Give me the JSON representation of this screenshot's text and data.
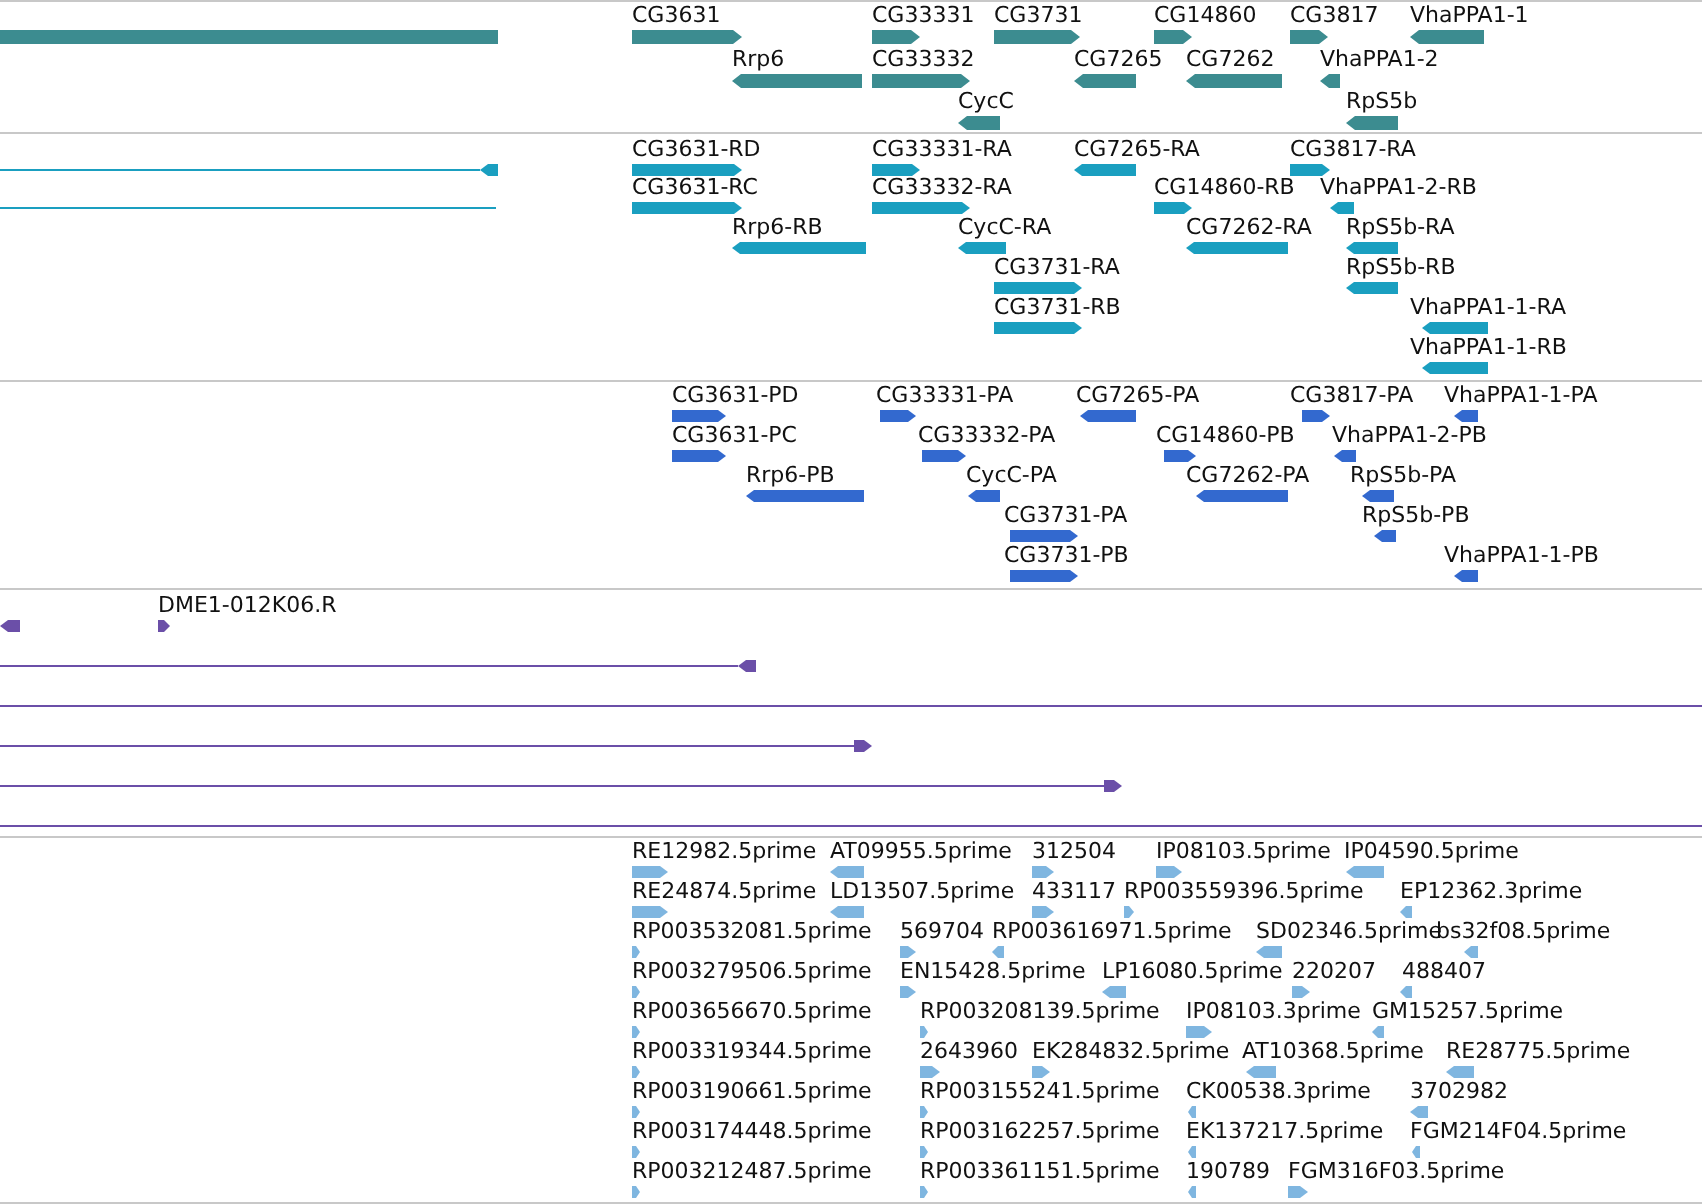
{
  "tracks": [
    {
      "kind": "gene",
      "color": "#3c8c90",
      "features": [
        {
          "kind": "plain"
        },
        {
          "label": "CG3631",
          "kind": "forward"
        },
        {
          "label": "CG33331",
          "kind": "forward"
        },
        {
          "label": "CG3731",
          "kind": "forward"
        },
        {
          "label": "CG14860",
          "kind": "forward"
        },
        {
          "label": "CG3817",
          "kind": "forward"
        },
        {
          "label": "VhaPPA1-1",
          "kind": "reverse"
        },
        {
          "label": "Rrp6",
          "kind": "reverse"
        },
        {
          "label": "CG33332",
          "kind": "forward"
        },
        {
          "label": "CG7265",
          "kind": "reverse"
        },
        {
          "label": "CG7262",
          "kind": "reverse"
        },
        {
          "label": "VhaPPA1-2",
          "kind": "reverse"
        },
        {
          "label": "CycC",
          "kind": "reverse"
        },
        {
          "label": "RpS5b",
          "kind": "reverse"
        }
      ]
    },
    {
      "kind": "transcript",
      "color": "#1a9fc0",
      "features": [
        {
          "kind": "reverse"
        },
        {
          "label": "CG3631-RD",
          "kind": "forward"
        },
        {
          "label": "CG33331-RA",
          "kind": "forward"
        },
        {
          "label": "CG7265-RA",
          "kind": "reverse"
        },
        {
          "label": "CG3817-RA",
          "kind": "forward"
        },
        {
          "kind": "plain"
        },
        {
          "label": "CG3631-RC",
          "kind": "forward"
        },
        {
          "label": "CG33332-RA",
          "kind": "forward"
        },
        {
          "label": "CG14860-RB",
          "kind": "forward"
        },
        {
          "label": "VhaPPA1-2-RB",
          "kind": "reverse"
        },
        {
          "label": "Rrp6-RB",
          "kind": "reverse"
        },
        {
          "label": "CycC-RA",
          "kind": "reverse"
        },
        {
          "label": "CG7262-RA",
          "kind": "reverse"
        },
        {
          "label": "RpS5b-RA",
          "kind": "reverse"
        },
        {
          "label": "CG3731-RA",
          "kind": "forward"
        },
        {
          "label": "RpS5b-RB",
          "kind": "reverse"
        },
        {
          "label": "CG3731-RB",
          "kind": "forward"
        },
        {
          "label": "VhaPPA1-1-RA",
          "kind": "reverse"
        },
        {
          "label": "VhaPPA1-1-RB",
          "kind": "reverse"
        }
      ]
    },
    {
      "kind": "protein",
      "color": "#3369cf",
      "features": [
        {
          "label": "CG3631-PD",
          "kind": "forward"
        },
        {
          "label": "CG33331-PA",
          "kind": "forward"
        },
        {
          "label": "CG7265-PA",
          "kind": "reverse"
        },
        {
          "label": "CG3817-PA",
          "kind": "forward"
        },
        {
          "label": "VhaPPA1-1-PA",
          "kind": "reverse"
        },
        {
          "label": "CG3631-PC",
          "kind": "forward"
        },
        {
          "label": "CG33332-PA",
          "kind": "forward"
        },
        {
          "label": "CG14860-PB",
          "kind": "forward"
        },
        {
          "label": "VhaPPA1-2-PB",
          "kind": "reverse"
        },
        {
          "label": "Rrp6-PB",
          "kind": "reverse"
        },
        {
          "label": "CycC-PA",
          "kind": "reverse"
        },
        {
          "label": "CG7262-PA",
          "kind": "reverse"
        },
        {
          "label": "RpS5b-PA",
          "kind": "reverse"
        },
        {
          "label": "CG3731-PA",
          "kind": "forward"
        },
        {
          "label": "RpS5b-PB",
          "kind": "reverse"
        },
        {
          "label": "CG3731-PB",
          "kind": "forward"
        },
        {
          "label": "VhaPPA1-1-PB",
          "kind": "reverse"
        }
      ]
    },
    {
      "kind": "clone",
      "color": "#6b4fa8",
      "features": [
        {
          "kind": "reverse"
        },
        {
          "label": "DME1-012K06.R",
          "kind": "forward"
        },
        {
          "kind": "reverse"
        },
        {
          "kind": "plain"
        },
        {
          "kind": "forward"
        },
        {
          "kind": "forward"
        },
        {
          "kind": "plain"
        }
      ]
    },
    {
      "kind": "est",
      "color": "#7fb6e0",
      "features": [
        {
          "label": "RE12982.5prime",
          "kind": "forward"
        },
        {
          "label": "AT09955.5prime",
          "kind": "reverse"
        },
        {
          "label": "312504",
          "kind": "forward"
        },
        {
          "label": "IP08103.5prime",
          "kind": "forward"
        },
        {
          "label": "IP04590.5prime",
          "kind": "reverse"
        },
        {
          "label": "RE24874.5prime",
          "kind": "forward"
        },
        {
          "label": "LD13507.5prime",
          "kind": "reverse"
        },
        {
          "label": "433117",
          "kind": "forward"
        },
        {
          "label": "RP003559396.5prime",
          "kind": "forward"
        },
        {
          "label": "EP12362.3prime",
          "kind": "reverse"
        },
        {
          "label": "RP003532081.5prime",
          "kind": "forward"
        },
        {
          "label": "569704",
          "kind": "forward"
        },
        {
          "label": "RP003616971.5prime",
          "kind": "reverse"
        },
        {
          "label": "SD02346.5prime",
          "kind": "reverse"
        },
        {
          "label": "bs32f08.5prime",
          "kind": "reverse"
        },
        {
          "label": "RP003279506.5prime",
          "kind": "forward"
        },
        {
          "label": "EN15428.5prime",
          "kind": "forward"
        },
        {
          "label": "LP16080.5prime",
          "kind": "reverse"
        },
        {
          "label": "220207",
          "kind": "forward"
        },
        {
          "label": "488407",
          "kind": "reverse"
        },
        {
          "label": "RP003656670.5prime",
          "kind": "forward"
        },
        {
          "label": "RP003208139.5prime",
          "kind": "forward"
        },
        {
          "label": "IP08103.3prime",
          "kind": "forward"
        },
        {
          "label": "GM15257.5prime",
          "kind": "reverse"
        },
        {
          "label": "RP003319344.5prime",
          "kind": "forward"
        },
        {
          "label": "2643960",
          "kind": "forward"
        },
        {
          "label": "EK284832.5prime",
          "kind": "forward"
        },
        {
          "label": "AT10368.5prime",
          "kind": "reverse"
        },
        {
          "label": "RE28775.5prime",
          "kind": "reverse"
        },
        {
          "label": "RP003190661.5prime",
          "kind": "forward"
        },
        {
          "label": "RP003155241.5prime",
          "kind": "forward"
        },
        {
          "label": "CK00538.3prime",
          "kind": "reverse"
        },
        {
          "label": "3702982",
          "kind": "reverse"
        },
        {
          "label": "RP003174448.5prime",
          "kind": "forward"
        },
        {
          "label": "RP003162257.5prime",
          "kind": "forward"
        },
        {
          "label": "EK137217.5prime",
          "kind": "reverse"
        },
        {
          "label": "FGM214F04.5prime",
          "kind": "reverse"
        },
        {
          "label": "RP003212487.5prime",
          "kind": "forward"
        },
        {
          "label": "RP003361151.5prime",
          "kind": "forward"
        },
        {
          "label": "190789",
          "kind": "reverse"
        },
        {
          "label": "FGM316F03.5prime",
          "kind": "forward"
        }
      ]
    }
  ]
}
